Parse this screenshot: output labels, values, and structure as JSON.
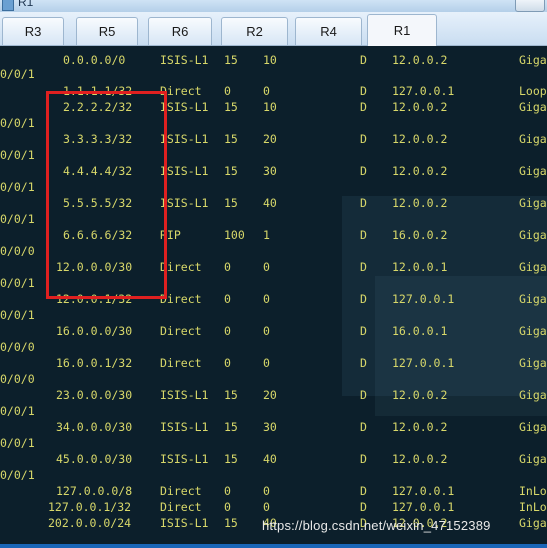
{
  "window": {
    "title": "R1"
  },
  "tabs": [
    {
      "label": "R3",
      "active": false
    },
    {
      "label": "R5",
      "active": false
    },
    {
      "label": "R6",
      "active": false
    },
    {
      "label": "R2",
      "active": false
    },
    {
      "label": "R4",
      "active": false
    },
    {
      "label": "R1",
      "active": true
    }
  ],
  "routes": [
    {
      "dest": "0.0.0.0/0",
      "proto": "ISIS-L1",
      "pre": "15",
      "cost": "10",
      "flags": "D",
      "nexthop": "12.0.0.2",
      "iface": "Giga",
      "iface_tail": "0/0/1"
    },
    {
      "dest": "1.1.1.1/32",
      "proto": "Direct",
      "pre": "0",
      "cost": "0",
      "flags": "D",
      "nexthop": "127.0.0.1",
      "iface": "Loop",
      "iface_tail": ""
    },
    {
      "dest": "2.2.2.2/32",
      "proto": "ISIS-L1",
      "pre": "15",
      "cost": "10",
      "flags": "D",
      "nexthop": "12.0.0.2",
      "iface": "Giga",
      "iface_tail": "0/0/1"
    },
    {
      "dest": "3.3.3.3/32",
      "proto": "ISIS-L1",
      "pre": "15",
      "cost": "20",
      "flags": "D",
      "nexthop": "12.0.0.2",
      "iface": "Giga",
      "iface_tail": "0/0/1"
    },
    {
      "dest": "4.4.4.4/32",
      "proto": "ISIS-L1",
      "pre": "15",
      "cost": "30",
      "flags": "D",
      "nexthop": "12.0.0.2",
      "iface": "Giga",
      "iface_tail": "0/0/1"
    },
    {
      "dest": "5.5.5.5/32",
      "proto": "ISIS-L1",
      "pre": "15",
      "cost": "40",
      "flags": "D",
      "nexthop": "12.0.0.2",
      "iface": "Giga",
      "iface_tail": "0/0/1"
    },
    {
      "dest": "6.6.6.6/32",
      "proto": "RIP",
      "pre": "100",
      "cost": "1",
      "flags": "D",
      "nexthop": "16.0.0.2",
      "iface": "Giga",
      "iface_tail": "0/0/0"
    },
    {
      "dest": "12.0.0.0/30",
      "proto": "Direct",
      "pre": "0",
      "cost": "0",
      "flags": "D",
      "nexthop": "12.0.0.1",
      "iface": "Giga",
      "iface_tail": "0/0/1"
    },
    {
      "dest": "12.0.0.1/32",
      "proto": "Direct",
      "pre": "0",
      "cost": "0",
      "flags": "D",
      "nexthop": "127.0.0.1",
      "iface": "Giga",
      "iface_tail": "0/0/1"
    },
    {
      "dest": "16.0.0.0/30",
      "proto": "Direct",
      "pre": "0",
      "cost": "0",
      "flags": "D",
      "nexthop": "16.0.0.1",
      "iface": "Giga",
      "iface_tail": "0/0/0"
    },
    {
      "dest": "16.0.0.1/32",
      "proto": "Direct",
      "pre": "0",
      "cost": "0",
      "flags": "D",
      "nexthop": "127.0.0.1",
      "iface": "Giga",
      "iface_tail": "0/0/0"
    },
    {
      "dest": "23.0.0.0/30",
      "proto": "ISIS-L1",
      "pre": "15",
      "cost": "20",
      "flags": "D",
      "nexthop": "12.0.0.2",
      "iface": "Giga",
      "iface_tail": "0/0/1"
    },
    {
      "dest": "34.0.0.0/30",
      "proto": "ISIS-L1",
      "pre": "15",
      "cost": "30",
      "flags": "D",
      "nexthop": "12.0.0.2",
      "iface": "Giga",
      "iface_tail": "0/0/1"
    },
    {
      "dest": "45.0.0.0/30",
      "proto": "ISIS-L1",
      "pre": "15",
      "cost": "40",
      "flags": "D",
      "nexthop": "12.0.0.2",
      "iface": "Giga",
      "iface_tail": "0/0/1"
    },
    {
      "dest": "127.0.0.0/8",
      "proto": "Direct",
      "pre": "0",
      "cost": "0",
      "flags": "D",
      "nexthop": "127.0.0.1",
      "iface": "InLo",
      "iface_tail": ""
    },
    {
      "dest": "127.0.0.1/32",
      "proto": "Direct",
      "pre": "0",
      "cost": "0",
      "flags": "D",
      "nexthop": "127.0.0.1",
      "iface": "InLo",
      "iface_tail": ""
    },
    {
      "dest": "202.0.0.0/24",
      "proto": "ISIS-L1",
      "pre": "15",
      "cost": "40",
      "flags": "D",
      "nexthop": "12.0.0.2",
      "iface": "Giga",
      "iface_tail": ""
    }
  ],
  "watermark": "https://blog.csdn.net/weixin_47152389",
  "colors": {
    "terminal_bg": "#0c1f2b",
    "terminal_text": "#d8d86a",
    "highlight": "#e02020"
  }
}
